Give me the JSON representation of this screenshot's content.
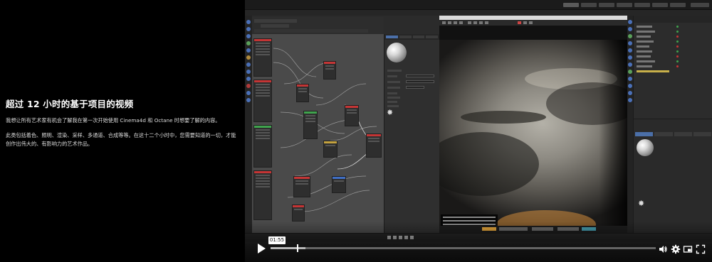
{
  "description": {
    "heading": "超过 12 小时的基于项目的视频",
    "paragraph1": "我想让所有艺术家有机会了解我在第一次开始使用 Cinema4d 和 Octane 时想要了解的内容。",
    "paragraph2": "此类包括着色、照明、渲染、采样、多通道、合成等等。在这十二个小时中，您需要知道的一切，才能创作出伟大的、有影响力的艺术作品。"
  },
  "player": {
    "time_label": "01:55",
    "progress_fraction": 0.07,
    "buffered_fraction": 0.09,
    "icons": [
      "play-icon",
      "volume-icon",
      "settings-gear-icon",
      "picture-in-picture-icon",
      "fullscreen-icon"
    ]
  },
  "colors": {
    "accent_blue": "#4a70b8",
    "node_red": "#c43535",
    "node_green": "#3fa34d",
    "background": "#000000"
  }
}
